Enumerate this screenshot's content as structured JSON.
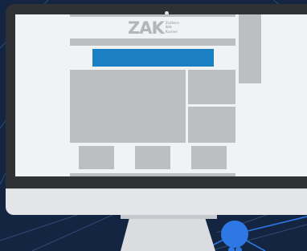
{
  "scene": {
    "colors": {
      "background": "#142542",
      "monitor_bezel": "#2f3135",
      "screen_bg": "#f1f2f4",
      "placeholder": "#bcbec1",
      "banner": "#1b7fc3",
      "monitor_body": "#e3e5e8",
      "network_accent": "#2d78e4"
    }
  },
  "page": {
    "logo": {
      "main": "ZAK",
      "lines": [
        "Zollern",
        "Alb",
        "Kurier"
      ]
    }
  }
}
